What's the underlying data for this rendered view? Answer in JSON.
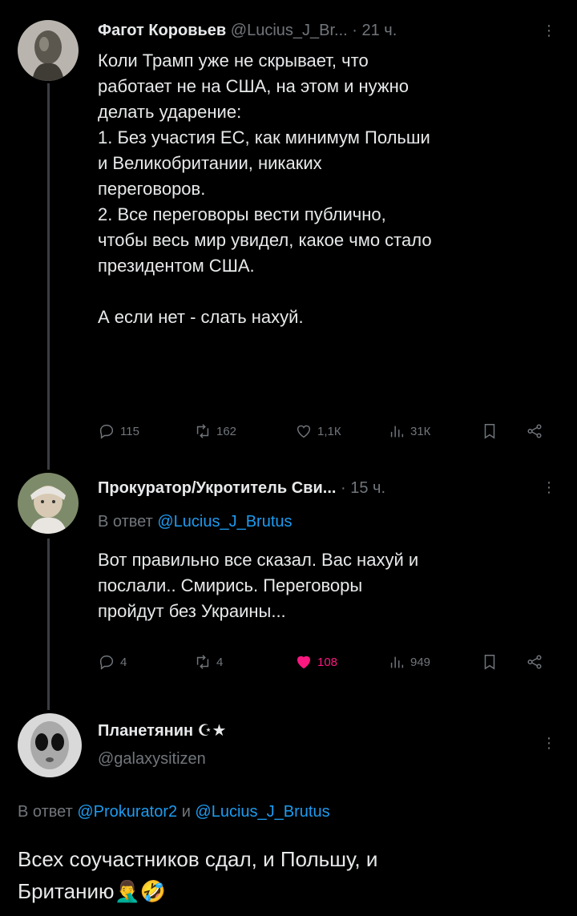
{
  "tweets": [
    {
      "name": "Фагот Коровьев",
      "handle": "@Lucius_J_Br...",
      "time": "· 21 ч.",
      "text": "Коли Трамп уже не скрывает, что\nработает не на США, на этом и нужно\nделать ударение:\n1. Без участия ЕС, как минимум Польши\nи Великобритании, никаких\nпереговоров.\n2. Все переговоры вести публично,\nчтобы весь мир увидел, какое чмо стало\nпрезидентом США.\n\nА если нет - слать нахуй.",
      "replies": "115",
      "retweets": "162",
      "likes": "1,1К",
      "views": "31К"
    },
    {
      "name": "Прокуратор/Укротитель Сви...",
      "time": "· 15 ч.",
      "reply_prefix": "В ответ",
      "reply_handle": "@Lucius_J_Brutus",
      "text": "Вот правильно все сказал. Вас нахуй и\nпослали.. Смирись. Переговоры\nпройдут без Украины...",
      "replies": "4",
      "retweets": "4",
      "likes": "108",
      "views": "949"
    },
    {
      "name": "Планетянин ☪★",
      "handle": "@galaxysitizen",
      "reply_prefix": "В ответ",
      "reply_handle_1": "@Prokurator2",
      "reply_and": "и",
      "reply_handle_2": "@Lucius_J_Brutus",
      "text": "Всех соучастников сдал, и Польшу, и\nБританию🤦‍♂️🤣"
    }
  ],
  "more_glyph": "⋮",
  "colors": {
    "background": "#000000",
    "text": "#e7e9ea",
    "muted": "#71767b",
    "link": "#1d9bf0",
    "like": "#f91880",
    "thread_line": "#3a3d41"
  },
  "icons": [
    "reply-icon",
    "retweet-icon",
    "like-icon",
    "views-icon",
    "bookmark-icon",
    "share-icon"
  ]
}
